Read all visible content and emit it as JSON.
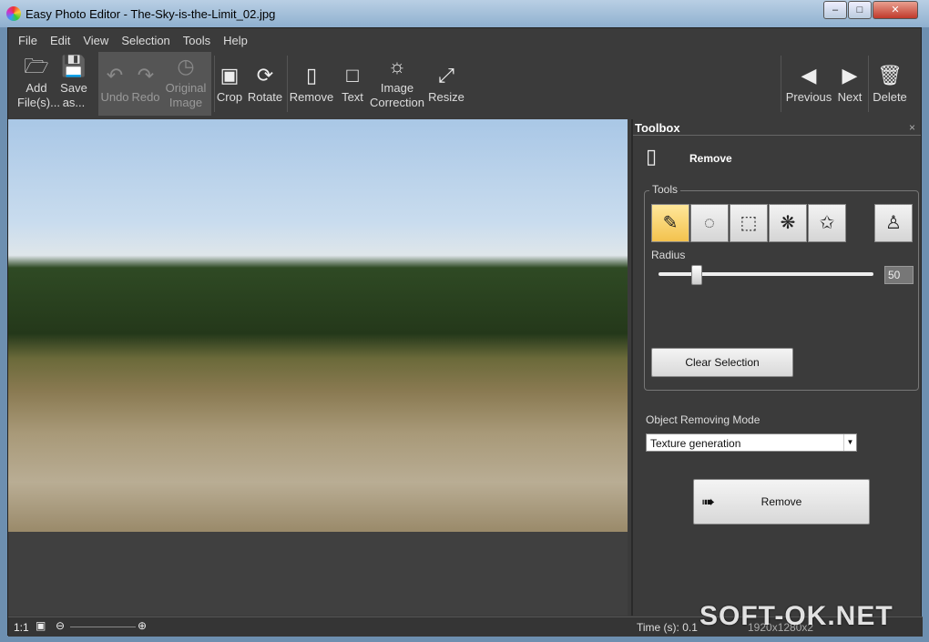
{
  "window": {
    "title": "Easy Photo Editor - The-Sky-is-the-Limit_02.jpg"
  },
  "menu": [
    "File",
    "Edit",
    "View",
    "Selection",
    "Tools",
    "Help"
  ],
  "toolbar": {
    "add": "Add File(s)...",
    "save": "Save as...",
    "undo": "Undo",
    "redo": "Redo",
    "original": "Original Image",
    "crop": "Crop",
    "rotate": "Rotate",
    "remove": "Remove",
    "text": "Text",
    "correction": "Image Correction",
    "resize": "Resize",
    "previous": "Previous",
    "next": "Next",
    "delete": "Delete"
  },
  "toolbox": {
    "title": "Toolbox",
    "heading": "Remove",
    "tools_label": "Tools",
    "radius_label": "Radius",
    "radius_value": "50",
    "clear_selection": "Clear Selection",
    "mode_label": "Object Removing Mode",
    "mode_value": "Texture generation",
    "remove_button": "Remove"
  },
  "status": {
    "zoom": "1:1",
    "time": "Time (s): 0.1",
    "dimensions": "1920x1280x2"
  },
  "watermark": "SOFT-OK.NET"
}
